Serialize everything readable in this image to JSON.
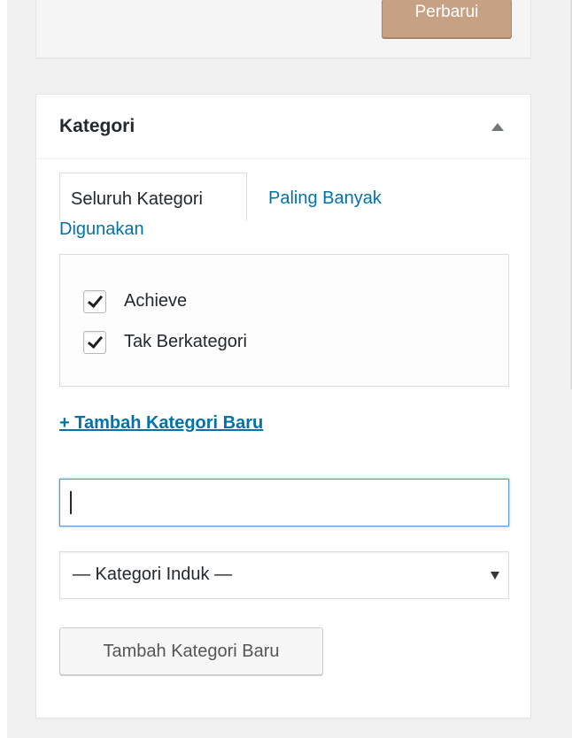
{
  "publish": {
    "update_label": "Perbarui"
  },
  "category_box": {
    "title": "Kategori",
    "toggle_icon": "triangle-up-icon",
    "tabs": [
      {
        "label": "Seluruh Kategori",
        "active": true
      },
      {
        "label_line1": "Paling Banyak",
        "label_line2": "Digunakan",
        "active": false
      }
    ],
    "items": [
      {
        "label": "Achieve",
        "checked": true
      },
      {
        "label": "Tak Berkategori",
        "checked": true
      }
    ],
    "add_link": "+ Tambah Kategori Baru",
    "new_category_input": {
      "value": "",
      "placeholder": ""
    },
    "parent_select": {
      "selected": "— Kategori Induk —"
    },
    "add_button": "Tambah Kategori Baru"
  },
  "colors": {
    "background": "#f1f1f1",
    "link": "#0073aa",
    "update_button": "#c7a183",
    "focus_border": "#5b9dd9"
  }
}
